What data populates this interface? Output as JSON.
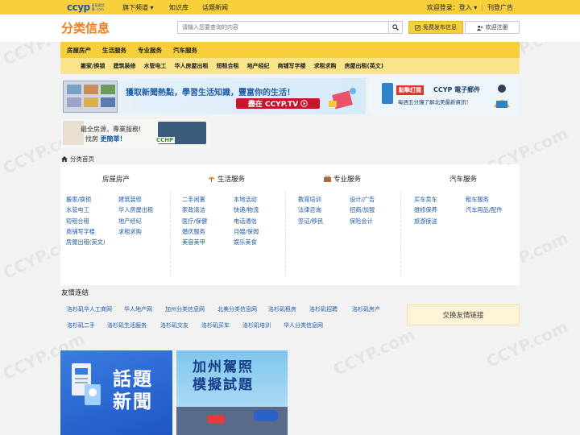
{
  "topbar": {
    "logo_text": "ccyp",
    "logo_sub": "星島電話簿 .com",
    "nav": [
      "旗下频道 ▾",
      "知识库",
      "话题新闻"
    ],
    "login_prompt": "欢迎登录：",
    "login": "登入 ▾",
    "advertise": "刊登广告"
  },
  "header": {
    "brand": "分类信息",
    "search_placeholder": "请输入您要查询的内容",
    "post_button": "免费发布信息",
    "register_button": "欢迎注册"
  },
  "categories": {
    "main": [
      "房屋房产",
      "生活服务",
      "专业服务",
      "汽车服务"
    ],
    "sub": [
      "搬家/换锁",
      "建筑装修",
      "水管电工",
      "华人房屋出租",
      "短租合租",
      "地产经纪",
      "商铺写字楼",
      "求租求购",
      "房屋出租(英文)"
    ]
  },
  "banners": {
    "tv_text": "獲取新聞熱點，學習生活知識，豐富你的生活！",
    "tv_pill": "盡在 CCYP.TV",
    "mail_tag": "點擊訂閱",
    "mail_title": "CCYP 電子郵件",
    "mail_sub": "每週五分鐘了解北美最新資訊！",
    "house_line1": "最全房源，專業服務!",
    "house_line2_pre": "找房",
    "house_line2_bold": "更簡單！",
    "house_logo": "CCHP"
  },
  "breadcrumb": "分类首页",
  "directory": [
    {
      "heading": "房屋房产",
      "links": [
        "搬家/换锁",
        "建筑装修",
        "水管电工",
        "华人房屋出租",
        "短租合租",
        "地产经纪",
        "商铺写字楼",
        "求租求购",
        "房屋出租(英文)"
      ]
    },
    {
      "heading": "生活服务",
      "links": [
        "二手闲置",
        "本地活动",
        "家政清洁",
        "快递/物流",
        "医疗/保健",
        "电话通信",
        "婚庆服务",
        "月嫂/保姆",
        "美容美甲",
        "娱乐美食"
      ]
    },
    {
      "heading": "专业服务",
      "links": [
        "教育培训",
        "设计/广告",
        "法律咨询",
        "招商/加盟",
        "签证/移民",
        "保险会计"
      ]
    },
    {
      "heading": "汽车服务",
      "links": [
        "买车卖车",
        "租车服务",
        "维修保养",
        "汽车用品/配件",
        "旅游接送"
      ]
    }
  ],
  "friends": {
    "title": "友情连结",
    "links_row1": [
      "洛杉矶华人工商网",
      "华人地产网",
      "加州分类信息网",
      "北美分类信息网",
      "洛杉矶租房",
      "洛杉矶招聘",
      "洛杉矶房产"
    ],
    "links_row2": [
      "洛杉矶二手",
      "洛杉矶生活服务",
      "洛杉矶交友",
      "洛杉矶买车",
      "洛杉矶培训",
      "华人分类信息网"
    ],
    "exchange_button": "交换友情链接"
  },
  "tiles": {
    "news": "話題新聞",
    "driving_line1": "加州駕照",
    "driving_line2": "模擬試題"
  },
  "watermark": "CCYP.com"
}
